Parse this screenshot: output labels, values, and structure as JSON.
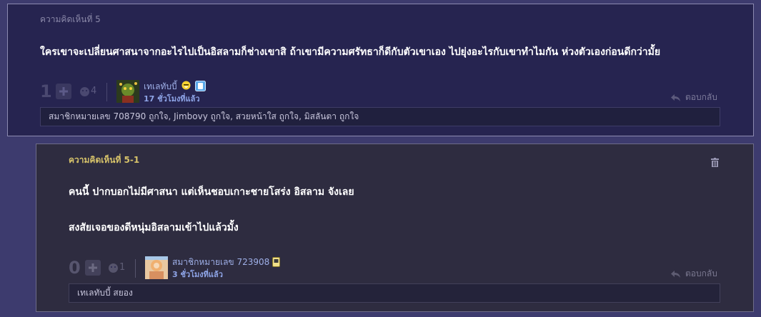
{
  "comment": {
    "title": "ความคิดเห็นที่ 5",
    "body": "ใครเขาจะเปลี่ยนศาสนาจากอะไรไปเป็นอิสลามก็ช่างเขาสิ ถ้าเขามีความศรัทธาก็ดีกับตัวเขาเอง ไปยุ่งอะไรกับเขาทำไมกัน ห่วงตัวเองก่อนดีกว่ามั้ย",
    "votes": "1",
    "emotion_count": "4",
    "author": "เทเลทับบี้",
    "time": "17 ชั่วโมงที่แล้ว",
    "reply_label": "ตอบกลับ",
    "likes": "สมาชิกหมายเลข 708790 ถูกใจ, Jimbovy ถูกใจ, สวยหน้าใส ถูกใจ, มิสลันตา ถูกใจ"
  },
  "reply": {
    "title": "ความคิดเห็นที่ 5-1",
    "body_lines": [
      "คนนี้ ปากบอกไม่มีศาสนา แต่เห็นชอบเกาะชายโสร่ง อิสลาม จังเลย",
      "สงสัยเจอของดีหนุ่มอิสลามเข้าไปแล้วมั้ง"
    ],
    "votes": "0",
    "emotion_count": "1",
    "author": "สมาชิกหมายเลข 723908",
    "time": "3 ชั่วโมงที่แล้ว",
    "reply_label": "ตอบกลับ",
    "likes": "เทเลทับบี้ สยอง"
  },
  "icons": {
    "plus": "plus-icon",
    "emotion": "emotion-icon",
    "reply": "reply-arrow-icon",
    "delete": "trash-icon",
    "mood_badge": "smiley-badge-icon",
    "device_badge": "device-badge-icon"
  },
  "colors": {
    "page_bg": "#3d3b6e",
    "main_card_bg": "#262450",
    "reply_card_bg": "#2e2c40",
    "author_link": "#9fb0e8",
    "reply_title": "#d7c36a"
  }
}
